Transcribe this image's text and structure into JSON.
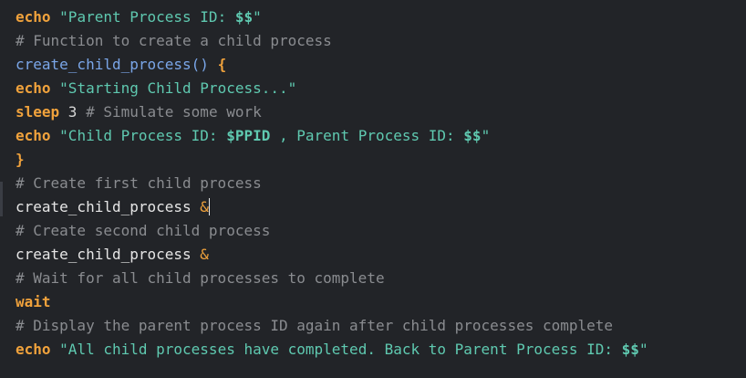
{
  "editor": {
    "lines": [
      {
        "parts": [
          {
            "t": "kw",
            "text": "echo"
          },
          {
            "t": "plain",
            "text": " "
          },
          {
            "t": "str",
            "text": "\"Parent Process ID: "
          },
          {
            "t": "var",
            "text": "$$"
          },
          {
            "t": "str",
            "text": "\""
          }
        ]
      },
      {
        "parts": [
          {
            "t": "cmt",
            "text": "# Function to create a child process"
          }
        ]
      },
      {
        "parts": [
          {
            "t": "fn",
            "text": "create_child_process()"
          },
          {
            "t": "plain",
            "text": " "
          },
          {
            "t": "brace",
            "text": "{"
          }
        ]
      },
      {
        "parts": [
          {
            "t": "kw",
            "text": "echo"
          },
          {
            "t": "plain",
            "text": " "
          },
          {
            "t": "str",
            "text": "\"Starting Child Process...\""
          }
        ]
      },
      {
        "parts": [
          {
            "t": "kw",
            "text": "sleep"
          },
          {
            "t": "num",
            "text": " 3 "
          },
          {
            "t": "cmt",
            "text": "# Simulate some work"
          }
        ]
      },
      {
        "parts": [
          {
            "t": "kw",
            "text": "echo"
          },
          {
            "t": "plain",
            "text": " "
          },
          {
            "t": "str",
            "text": "\"Child Process ID: "
          },
          {
            "t": "var",
            "text": "$PPID"
          },
          {
            "t": "str",
            "text": " , Parent Process ID: "
          },
          {
            "t": "var",
            "text": "$$"
          },
          {
            "t": "str",
            "text": "\""
          }
        ]
      },
      {
        "parts": [
          {
            "t": "brace",
            "text": "}"
          }
        ]
      },
      {
        "parts": [
          {
            "t": "cmt",
            "text": "# Create first child process"
          }
        ]
      },
      {
        "parts": [
          {
            "t": "plain",
            "text": "create_child_process "
          },
          {
            "t": "amp",
            "text": "&"
          }
        ],
        "caret": true
      },
      {
        "parts": [
          {
            "t": "cmt",
            "text": "# Create second child process"
          }
        ]
      },
      {
        "parts": [
          {
            "t": "plain",
            "text": "create_child_process "
          },
          {
            "t": "amp",
            "text": "&"
          }
        ]
      },
      {
        "parts": [
          {
            "t": "cmt",
            "text": "# Wait for all child processes to complete"
          }
        ]
      },
      {
        "parts": [
          {
            "t": "kw",
            "text": "wait"
          }
        ]
      },
      {
        "parts": [
          {
            "t": "cmt",
            "text": "# Display the parent process ID again after child processes complete"
          }
        ]
      },
      {
        "parts": [
          {
            "t": "kw",
            "text": "echo"
          },
          {
            "t": "plain",
            "text": " "
          },
          {
            "t": "str",
            "text": "\"All child processes have completed. Back to Parent Process ID: "
          },
          {
            "t": "var",
            "text": "$$"
          },
          {
            "t": "str",
            "text": "\""
          }
        ]
      }
    ]
  }
}
